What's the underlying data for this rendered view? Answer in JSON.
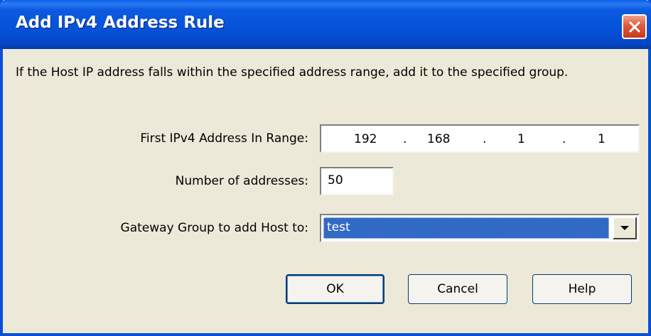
{
  "dialog": {
    "title": "Add IPv4 Address Rule",
    "description": "If the Host IP address falls within the specified address range, add it to the specified group.",
    "colors": {
      "titlebar": "#0552d8",
      "window_bg": "#ece9d8",
      "close_button": "#e05a3a",
      "selection": "#316ac5"
    }
  },
  "form": {
    "first_address_label": "First IPv4 Address In Range:",
    "first_address": {
      "octet1": "192",
      "octet2": "168",
      "octet3": "1",
      "octet4": "1",
      "separator": "."
    },
    "count_label": "Number of addresses:",
    "count_value": "50",
    "group_label": "Gateway Group to add Host to:",
    "group_value": "test"
  },
  "buttons": {
    "ok": "OK",
    "cancel": "Cancel",
    "help": "Help"
  },
  "icons": {
    "close": "close-icon",
    "dropdown": "chevron-down-icon"
  }
}
